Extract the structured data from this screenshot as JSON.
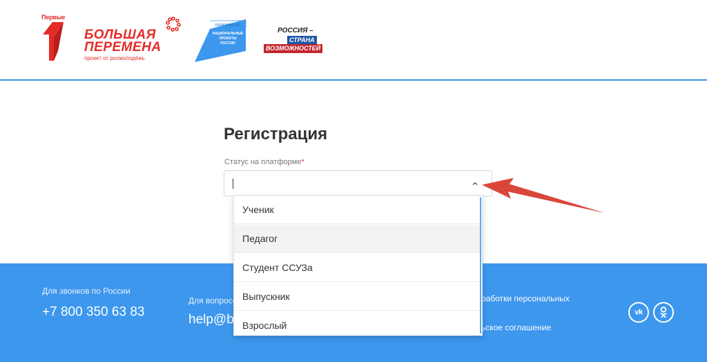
{
  "header": {
    "logo_pervye_label": "Первые",
    "logo_bp_line1": "БОЛЬШАЯ",
    "logo_bp_line2": "ПЕРЕМЕНА",
    "logo_bp_line3": "проект от росмолодёжь",
    "logo_np_line0": "ОБРАЗОВАНИЕ",
    "logo_np_line1": "НАЦИОНАЛЬНЫЕ",
    "logo_np_line2": "ПРОЕКТЫ",
    "logo_np_line3": "РОССИИ",
    "logo_rossiya_line1": "РОССИЯ –",
    "logo_rossiya_line2": "СТРАНА",
    "logo_rossiya_line3": "ВОЗМОЖНОСТЕЙ"
  },
  "form": {
    "title": "Регистрация",
    "status_label": "Статус на платформе",
    "required_mark": "*",
    "status_value": ""
  },
  "dropdown": {
    "options": [
      {
        "label": "Ученик",
        "highlighted": false
      },
      {
        "label": "Педагог",
        "highlighted": true
      },
      {
        "label": "Студент ССУЗа",
        "highlighted": false
      },
      {
        "label": "Выпускник",
        "highlighted": false
      },
      {
        "label": "Взрослый",
        "highlighted": false
      }
    ]
  },
  "footer": {
    "calls_label": "Для звонков по России",
    "phone": "+7 800 350 63 83",
    "questions_label": "Для вопросов",
    "email": "help@bolshayaperemena.online",
    "link_personal_data": "работки персональных",
    "link_agreement": "ьское соглашение",
    "social_vk": "vk",
    "social_ok": "ok-icon"
  },
  "colors": {
    "accent": "#3d97ed",
    "brand_red": "#e52a27",
    "arrow": "#d9473a"
  }
}
